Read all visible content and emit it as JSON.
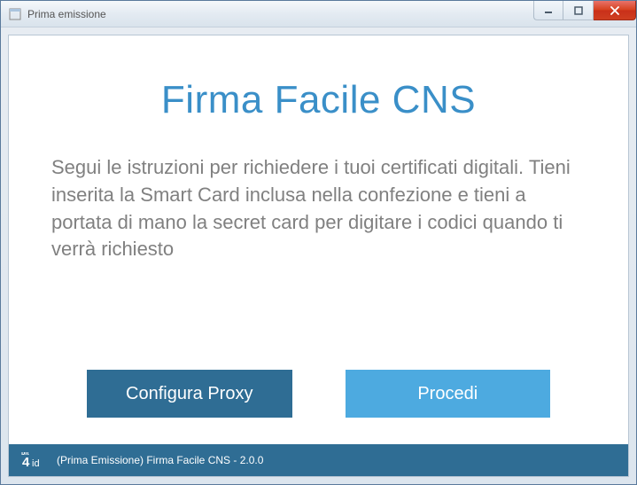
{
  "window": {
    "title": "Prima emissione"
  },
  "main": {
    "app_title": "Firma Facile CNS",
    "instructions": "Segui le istruzioni per richiedere i tuoi certificati digitali. Tieni inserita la Smart Card inclusa nella confezione e tieni a portata di mano la secret card per digitare i codici quando ti verrà richiesto"
  },
  "buttons": {
    "configure_proxy": "Configura Proxy",
    "proceed": "Procedi"
  },
  "statusbar": {
    "logo_text": "id",
    "text": "(Prima Emissione) Firma Facile CNS - 2.0.0"
  }
}
